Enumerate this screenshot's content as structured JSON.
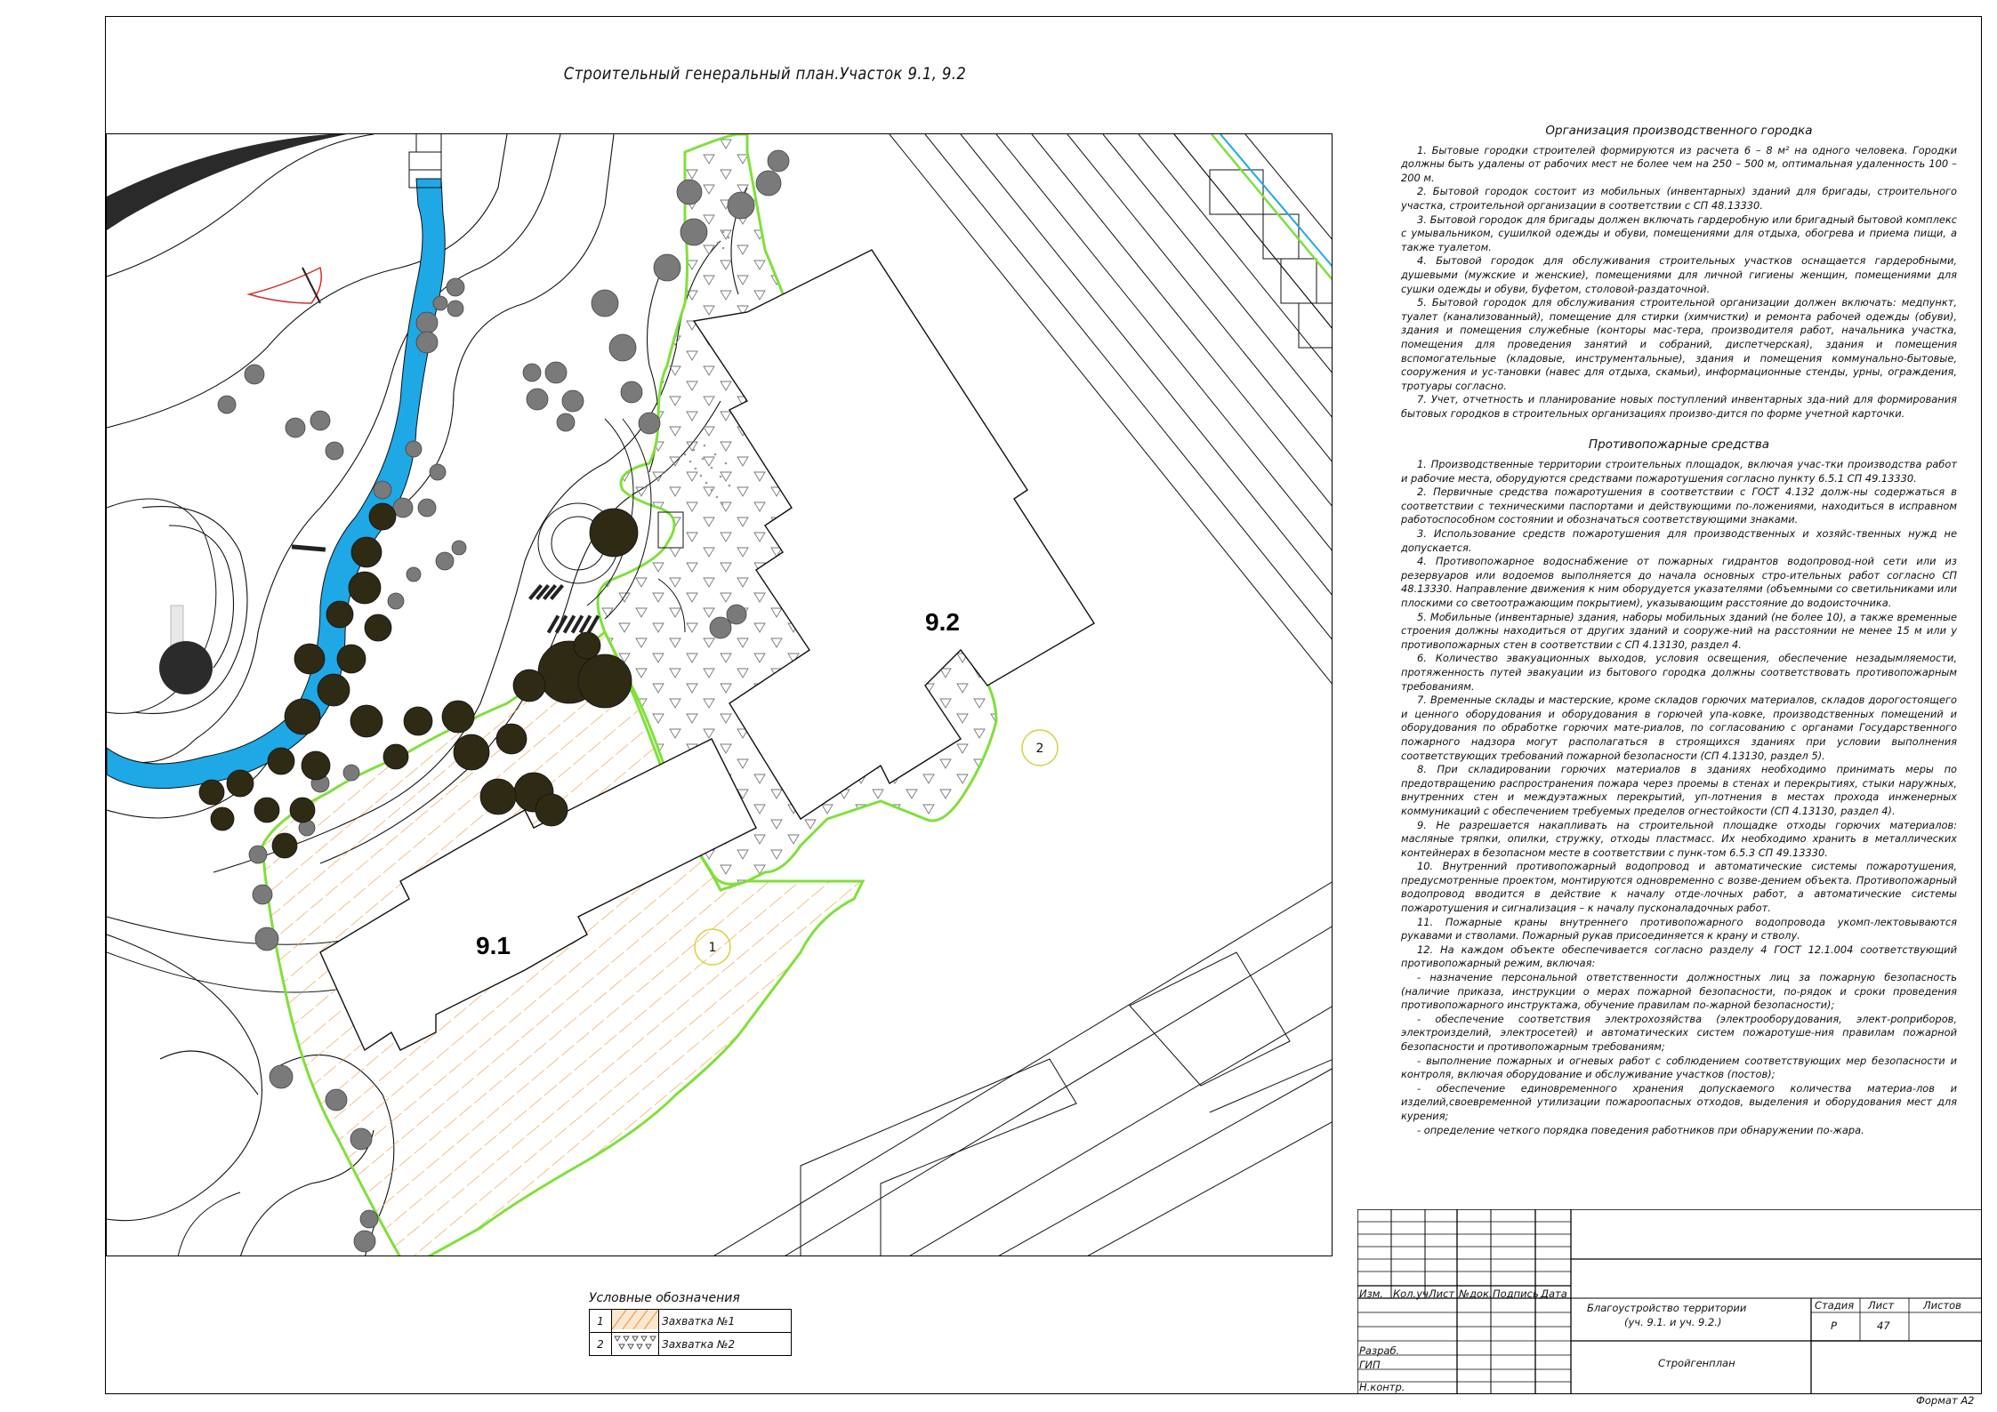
{
  "sheet": {
    "title": "Строительный генеральный план.Участок 9.1, 9.2",
    "format_label": "Формат А2"
  },
  "plan": {
    "plot_91_label": "9.1",
    "plot_92_label": "9.2",
    "zone_1_marker": "1",
    "zone_2_marker": "2",
    "colors": {
      "boundary": "#7fe03a",
      "hatch": "#e8a050",
      "water": "#1ea8e6",
      "tree_dark": "#2f2a14",
      "tree_grey": "#808080"
    }
  },
  "notes": {
    "section1_title": "Организация производственного городка",
    "section1_items": [
      "1. Бытовые городки строителей формируются из расчета 6 – 8 м² на одного человека. Городки должны быть удалены от рабочих мест не более чем на 250 – 500 м, оптимальная удаленность 100 – 200 м.",
      "2. Бытовой городок состоит из мобильных (инвентарных) зданий для бригады, строительного участка, строительной организации в соответствии с СП 48.13330.",
      "3. Бытовой городок для бригады должен включать гардеробную или бригадный бытовой комплекс с умывальником, сушилкой одежды и обуви, помещениями для отдыха, обогрева и приема пищи, а также туалетом.",
      "4. Бытовой городок для обслуживания строительных участков оснащается гардеробными, душевыми (мужские и женские), помещениями для личной гигиены женщин, помещениями для сушки одежды и обуви, буфетом, столовой-раздаточной.",
      "5. Бытовой городок для обслуживания строительной организации должен включать: медпункт, туалет (канализованный), помещение для стирки (химчистки) и ремонта рабочей одежды (обуви), здания и помещения служебные (конторы мас-тера, производителя работ, начальника участка, помещения для проведения занятий и собраний, диспетчерская), здания и помещения вспомогательные (кладовые, инструментальные), здания и помещения коммунально-бытовые, сооружения и ус-тановки (навес для отдыха, скамьи), информационные стенды, урны, ограждения, тротуары согласно.",
      "7. Учет, отчетность и планирование новых поступлений инвентарных зда-ний для формирования бытовых городков в строительных организациях произво-дится по форме учетной карточки."
    ],
    "section2_title": "Противопожарные средства",
    "section2_items": [
      "1. Производственные территории строительных площадок, включая учас-тки производства работ и рабочие места, оборудуются средствами пожаротушения согласно пункту 6.5.1 СП 49.13330.",
      "2. Первичные средства пожаротушения в соответствии с ГОСТ 4.132 долж-ны содержаться в соответствии с техническими паспортами и действующими по-ложениями, находиться в исправном работоспособном состоянии и обозначаться соответствующими знаками.",
      "3. Использование средств пожаротушения для производственных и хозяйс-твенных нужд не допускается.",
      "4. Противопожарное водоснабжение от пожарных гидрантов водопровод-ной сети или из резервуаров или водоемов выполняется до начала основных стро-ительных работ согласно СП 48.13330. Направление движения к ним оборудуется указателями (объемными со светильниками или плоскими со светоотражающим покрытием), указывающим расстояние до водоисточника.",
      "5. Мобильные (инвентарные) здания, наборы мобильных зданий (не более 10), а также временные строения должны находиться от других зданий и сооруже-ний на расстоянии не менее 15 м или у противопожарных стен в соответствии с СП 4.13130, раздел 4.",
      "6. Количество эвакуационных выходов, условия освещения, обеспечение незадымляемости, протяженность путей эвакуации из бытового городка должны соответствовать противопожарным требованиям.",
      "7. Временные склады и мастерские, кроме складов горючих материалов, складов дорогостоящего и ценного оборудования и оборудования в горючей упа-ковке, производственных помещений и оборудования по обработке горючих мате-риалов, по согласованию с органами Государственного пожарного надзора могут располагаться в строящихся зданиях при условии выполнения соответствующих требований пожарной безопасности (СП 4.13130, раздел 5).",
      "8. При складировании горючих материалов в зданиях необходимо принимать меры по предотвращению распространения пожара через проемы в стенах и перекрытиях, стыки наружных, внутренних стен и междуэтажных перекрытий, уп-лотнения в местах прохода инженерных коммуникаций с обеспечением требуемых пределов огнестойкости (СП 4.13130, раздел 4).",
      "9. Не разрешается накапливать на строительной площадке отходы горючих материалов: масляные тряпки, опилки, стружку, отходы пластмасс. Их необходимо хранить в металлических контейнерах в безопасном месте в соответствии с пунк-том 6.5.3 СП 49.13330.",
      "10. Внутренний противопожарный водопровод и автоматические системы пожаротушения, предусмотренные проектом, монтируются одновременно с возве-дением объекта. Противопожарный водопровод вводится в действие к началу отде-лочных работ, а автоматические системы пожаротушения и сигнализация – к началу пусконаладочных работ.",
      "11. Пожарные краны внутреннего противопожарного водопровода укомп-лектовываются рукавами и стволами. Пожарный рукав присоединяется к крану и стволу.",
      "12. На каждом объекте обеспечивается согласно разделу 4 ГОСТ 12.1.004 соответствующий противопожарный режим, включая:",
      "- назначение персональной ответственности должностных лиц за пожарную безопасность (наличие приказа, инструкции о мерах пожарной безопасности, по-рядок и сроки проведения противопожарного инструктажа, обучение правилам по-жарной безопасности);",
      "- обеспечение соответствия электрохозяйства (электрооборудования, элект-роприборов, электроизделий, электросетей) и автоматических систем пожаротуше-ния правилам пожарной безопасности и противопожарным требованиям;",
      "- выполнение пожарных и огневых работ с соблюдением соответствующих мер безопасности и контроля, включая оборудование и обслуживание участков (постов);",
      "- обеспечение единовременного хранения допускаемого количества материа-лов и изделий,своевременной утилизации пожароопасных отходов, выделения и оборудования мест для курения;",
      "- определение четкого порядка поведения работников при обнаружении по-жара."
    ]
  },
  "legend": {
    "title": "Условные обозначения",
    "rows": [
      {
        "num": "1",
        "label": "Захватка №1"
      },
      {
        "num": "2",
        "label": "Захватка №2"
      }
    ]
  },
  "stamp": {
    "col_headers": [
      "Изм.",
      "Кол.уч",
      "Лист",
      "№док.",
      "Подпись",
      "Дата"
    ],
    "roles": [
      "Разраб.",
      "ГИП",
      "Н.контр."
    ],
    "project_name_1": "Благоустройство территории",
    "project_name_2": "(уч. 9.1. и уч. 9.2.)",
    "sheet_name": "Стройгенплан",
    "stage_header": "Стадия",
    "sheet_header": "Лист",
    "sheets_header": "Листов",
    "stage_value": "Р",
    "sheet_value": "47"
  }
}
